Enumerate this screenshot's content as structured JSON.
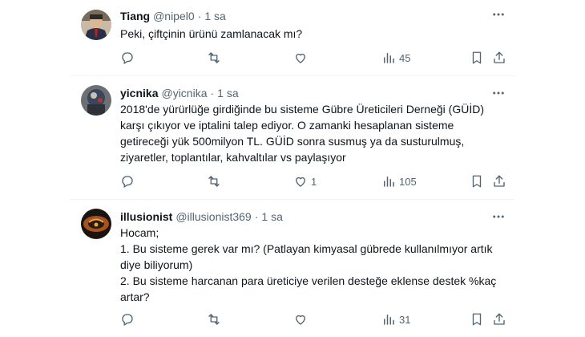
{
  "tweets": [
    {
      "name": "Tiang",
      "handle": "@nipel0",
      "dot": "·",
      "time": "1 sa",
      "lines": [
        "Peki, çiftçinin ürünü zamlanacak mı?"
      ],
      "replies": "",
      "retweets": "",
      "likes": "",
      "views": "45"
    },
    {
      "name": "yicnika",
      "handle": "@yicnika",
      "dot": "·",
      "time": "1 sa",
      "lines": [
        "2018'de yürürlüğe girdiğinde bu sisteme Gübre Üreticileri Derneği (GÜİD)",
        "karşı çıkıyor ve iptalini talep ediyor. O zamanki hesaplanan sisteme",
        "getireceği yük 500milyon TL. GÜİD sonra susmuş ya da susturulmuş,",
        "ziyaretler, toplantılar, kahvaltılar vs paylaşıyor"
      ],
      "replies": "",
      "retweets": "",
      "likes": "1",
      "views": "105"
    },
    {
      "name": "illusionist",
      "handle": "@illusionist369",
      "dot": "·",
      "time": "1 sa",
      "lines": [
        "Hocam;",
        "1. Bu sisteme gerek var mı? (Patlayan kimyasal gübrede kullanılmıyor artık",
        "diye biliyorum)",
        "2. Bu sisteme harcanan para üreticiye verilen desteğe eklense destek %kaç",
        "artar?"
      ],
      "replies": "",
      "retweets": "",
      "likes": "",
      "views": "31"
    }
  ],
  "icons": {
    "more": "more-horizontal-icon",
    "reply": "reply-icon",
    "retweet": "retweet-icon",
    "like": "heart-icon",
    "views": "views-icon",
    "bookmark": "bookmark-icon",
    "share": "share-icon"
  },
  "colors": {
    "text": "#0f1419",
    "secondary": "#536471",
    "divider": "#eff3f4"
  }
}
